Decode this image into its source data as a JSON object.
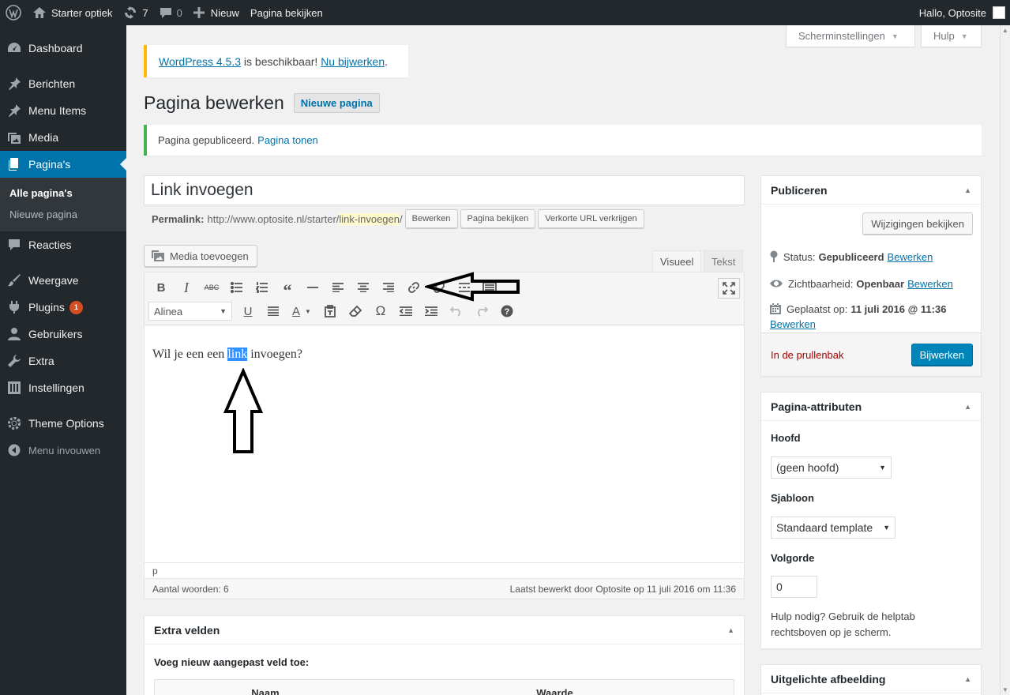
{
  "adminbar": {
    "site_name": "Starter optiek",
    "updates_count": "7",
    "comments_count": "0",
    "new_label": "Nieuw",
    "view_page": "Pagina bekijken",
    "greeting": "Hallo, Optosite"
  },
  "sidebar": {
    "items": [
      {
        "label": "Dashboard",
        "icon": "dashboard-icon"
      },
      {
        "label": "Berichten",
        "icon": "pin-icon"
      },
      {
        "label": "Menu Items",
        "icon": "pin-icon"
      },
      {
        "label": "Media",
        "icon": "media-icon"
      },
      {
        "label": "Pagina's",
        "icon": "page-icon"
      },
      {
        "label": "Reacties",
        "icon": "comment-icon"
      },
      {
        "label": "Weergave",
        "icon": "brush-icon"
      },
      {
        "label": "Plugins",
        "icon": "plugin-icon",
        "badge": "1"
      },
      {
        "label": "Gebruikers",
        "icon": "user-icon"
      },
      {
        "label": "Extra",
        "icon": "wrench-icon"
      },
      {
        "label": "Instellingen",
        "icon": "settings-icon"
      },
      {
        "label": "Theme Options",
        "icon": "gear-icon"
      }
    ],
    "submenu": [
      "Alle pagina's",
      "Nieuwe pagina"
    ],
    "collapse": "Menu invouwen"
  },
  "screen_options": {
    "options": "Scherminstellingen",
    "help": "Hulp"
  },
  "update_notice": {
    "version_link": "WordPress 4.5.3",
    "middle": " is beschikbaar! ",
    "update_link": "Nu bijwerken",
    "end": "."
  },
  "page_title": "Pagina bewerken",
  "add_new": "Nieuwe pagina",
  "success_notice": {
    "text": "Pagina gepubliceerd.",
    "link": "Pagina tonen"
  },
  "post_title": "Link invoegen",
  "permalink": {
    "label": "Permalink:",
    "base": "http://www.optosite.nl/starter/",
    "slug": "link-invoegen",
    "end": "/",
    "edit": "Bewerken",
    "view": "Pagina bekijken",
    "shortlink": "Verkorte URL verkrijgen"
  },
  "editor": {
    "media_button": "Media toevoegen",
    "tab_visual": "Visueel",
    "tab_text": "Tekst",
    "format": "Alinea",
    "content_before": "Wil je een een ",
    "content_selected": "link",
    "content_after": " invoegen?",
    "path": "p",
    "word_count": "Aantal woorden: 6",
    "last_edited": "Laatst bewerkt door Optosite op 11 juli 2016 om 11:36"
  },
  "custom_fields": {
    "title": "Extra velden",
    "add_new": "Voeg nieuw aangepast veld toe:",
    "col_name": "Naam",
    "col_value": "Waarde"
  },
  "publish": {
    "title": "Publiceren",
    "preview": "Wijzigingen bekijken",
    "status_label": "Status:",
    "status_value": "Gepubliceerd",
    "visibility_label": "Zichtbaarheid:",
    "visibility_value": "Openbaar",
    "date_label": "Geplaatst op:",
    "date_value": "11 juli 2016 @ 11:36",
    "edit": "Bewerken",
    "trash": "In de prullenbak",
    "update": "Bijwerken"
  },
  "page_attributes": {
    "title": "Pagina-attributen",
    "parent_label": "Hoofd",
    "parent_value": "(geen hoofd)",
    "template_label": "Sjabloon",
    "template_value": "Standaard template",
    "order_label": "Volgorde",
    "order_value": "0",
    "help": "Hulp nodig? Gebruik de helptab rechtsboven op je scherm."
  },
  "featured_image": {
    "title": "Uitgelichte afbeelding"
  },
  "colors": {
    "accent": "#0073aa",
    "sidebar": "#23282d",
    "primary_button": "#0085ba"
  }
}
